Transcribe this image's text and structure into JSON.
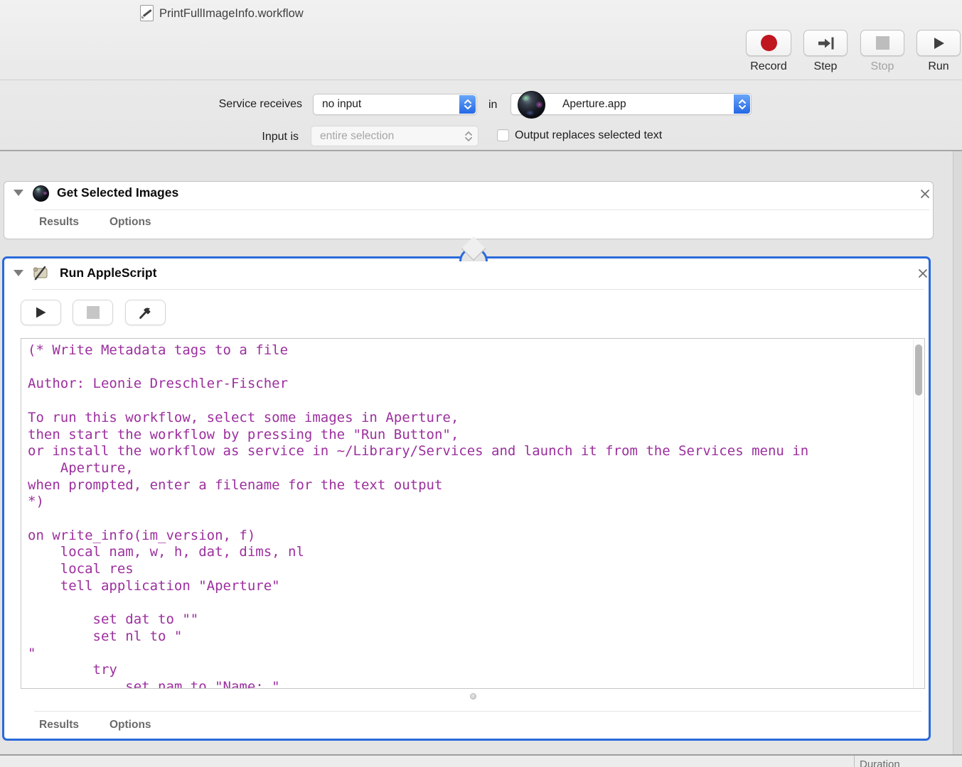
{
  "window": {
    "title": "PrintFullImageInfo.workflow"
  },
  "toolbar": {
    "buttons": [
      {
        "label": "Record",
        "icon": "record-icon",
        "enabled": true
      },
      {
        "label": "Step",
        "icon": "step-icon",
        "enabled": true
      },
      {
        "label": "Stop",
        "icon": "stop-icon",
        "enabled": false
      },
      {
        "label": "Run",
        "icon": "run-icon",
        "enabled": true
      }
    ]
  },
  "service_bar": {
    "receives_label": "Service receives",
    "receives_value": "no input",
    "in_label": "in",
    "app_name": "Aperture.app",
    "input_label": "Input is",
    "input_value": "entire selection",
    "output_checkbox_label": "Output replaces selected text",
    "output_checkbox_checked": false
  },
  "actions": [
    {
      "title": "Get Selected Images",
      "icon": "aperture-icon",
      "tabs": [
        "Results",
        "Options"
      ],
      "selected": false
    },
    {
      "title": "Run AppleScript",
      "icon": "applescript-icon",
      "tabs": [
        "Results",
        "Options"
      ],
      "selected": true,
      "editor_buttons": [
        {
          "icon": "play-icon",
          "enabled": true
        },
        {
          "icon": "stop-icon",
          "enabled": false
        },
        {
          "icon": "compile-hammer-icon",
          "enabled": true
        }
      ],
      "code_lines": [
        "(* Write Metadata tags to a file",
        "",
        "Author: Leonie Dreschler-Fischer",
        "",
        "To run this workflow, select some images in Aperture,",
        "then start the workflow by pressing the \"Run Button\",",
        "or install the workflow as service in ~/Library/Services and launch it from the Services menu in",
        "    Aperture,",
        "when prompted, enter a filename for the text output",
        "*)",
        "",
        "on write_info(im_version, f)",
        "    local nam, w, h, dat, dims, nl",
        "    local res",
        "    tell application \"Aperture\"",
        "",
        "        set dat to \"\"",
        "        set nl to \"",
        "\"",
        "        try",
        "            set nam to \"Name: \""
      ]
    }
  ],
  "status_bar": {
    "duration_label": "Duration"
  },
  "colors": {
    "selection_blue": "#2a6ada",
    "code_purple": "#9c2f9e",
    "record_red": "#c01620"
  },
  "icons": {
    "record": "red-circle",
    "step": "arrow-into-bar",
    "stop": "gray-square",
    "run": "right-triangle",
    "play": "right-triangle",
    "compile": "hammer",
    "close": "x-cross",
    "disclosure": "down-triangle",
    "popup-stepper": "up-down-chevrons",
    "aperture": "camera-lens",
    "applescript": "script-scroll",
    "workflow-doc": "page-with-pen"
  }
}
